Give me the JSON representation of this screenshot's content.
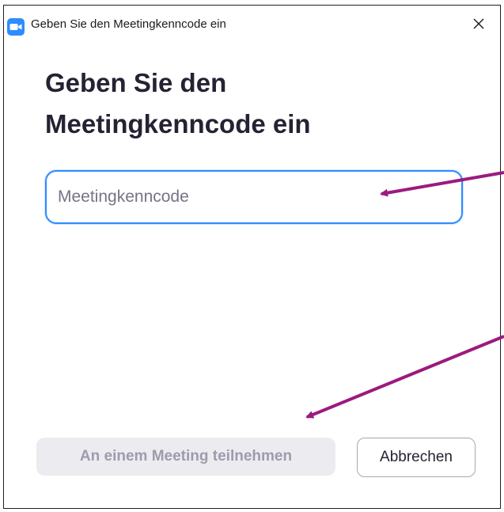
{
  "window": {
    "title": "Geben Sie den Meetingkenncode ein",
    "app_icon": "zoom-camera-icon",
    "close_icon": "close-icon",
    "accent_color": "#2d8cff"
  },
  "dialog": {
    "heading": "Geben Sie den Meetingkenncode ein",
    "passcode_input": {
      "value": "",
      "placeholder": "Meetingkenncode"
    },
    "join_button": {
      "label": "An einem Meeting teilnehmen",
      "state": "disabled"
    },
    "cancel_button": {
      "label": "Abbrechen"
    }
  },
  "annotations": {
    "arrow_color": "#9c1a7f"
  }
}
